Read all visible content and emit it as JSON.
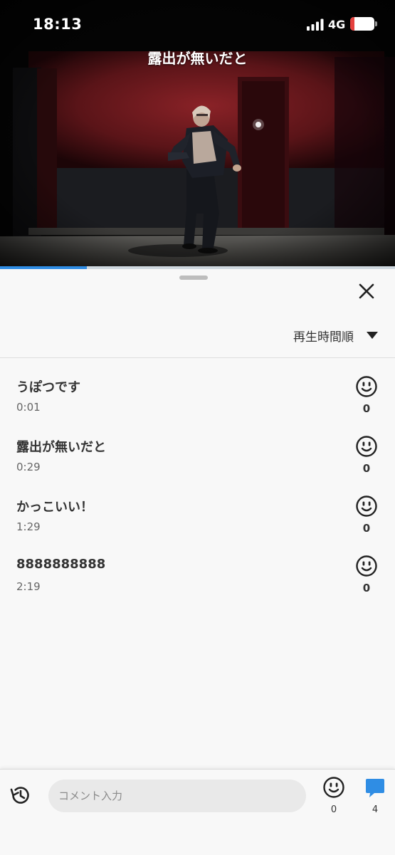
{
  "status_bar": {
    "time": "18:13",
    "network": "4G",
    "battery": "17",
    "battery_level": 0.17
  },
  "video": {
    "caption": "露出が無いだと",
    "progress": 0.22
  },
  "sheet": {
    "sort_label": "再生時間順"
  },
  "comments": [
    {
      "text": "うぽつです",
      "time": "0:01",
      "likes": "0"
    },
    {
      "text": "露出が無いだと",
      "time": "0:29",
      "likes": "0"
    },
    {
      "text": "かっこいい！",
      "time": "1:29",
      "likes": "0"
    },
    {
      "text": "8888888888",
      "time": "2:19",
      "likes": "0"
    }
  ],
  "bottom_bar": {
    "input_placeholder": "コメント入力",
    "like_count": "0",
    "comment_count": "4"
  },
  "colors": {
    "accent": "#2f8de4",
    "battery_low": "#e5413e"
  },
  "icons": [
    "signal-icon",
    "battery-icon",
    "close-icon",
    "dropdown-caret-icon",
    "smiley-icon",
    "history-icon",
    "comment-bubble-icon"
  ]
}
